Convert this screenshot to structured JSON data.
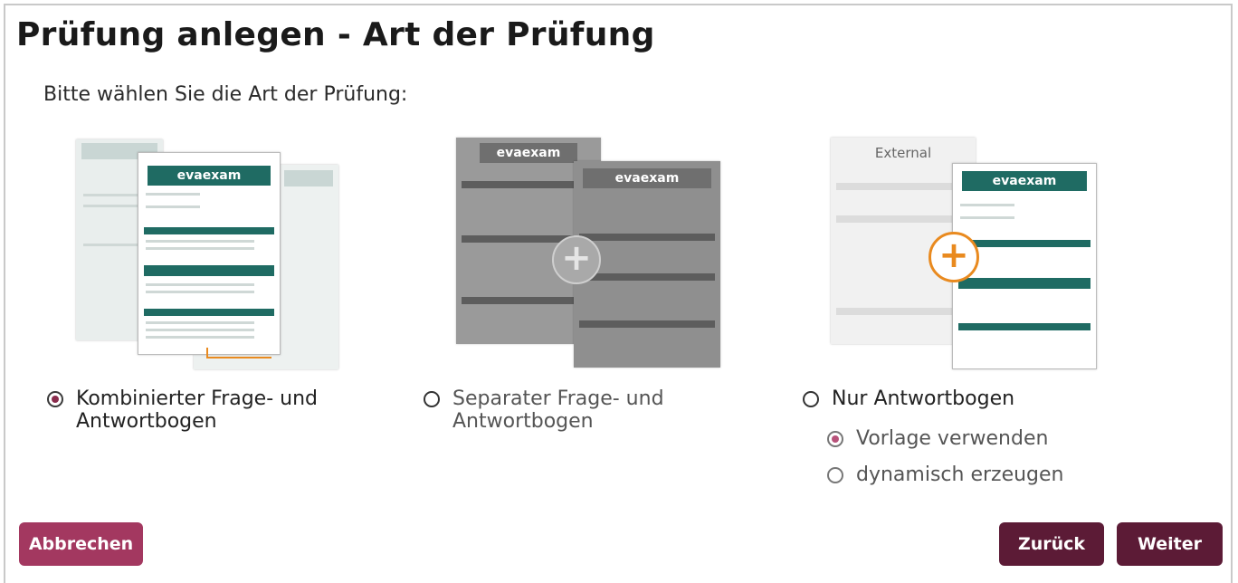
{
  "dialog": {
    "title": "Prüfung anlegen - Art der Prüfung",
    "prompt": "Bitte wählen Sie die Art der Prüfung:"
  },
  "illustrations": {
    "logo_text": "evaexam",
    "external_label": "External"
  },
  "options": [
    {
      "line1": "Kombinierter Frage- und",
      "line2": "Antwortbogen",
      "selected": true
    },
    {
      "line1": "Separater Frage- und",
      "line2": "Antwortbogen",
      "selected": false
    },
    {
      "line1": "Nur Antwortbogen",
      "line2": "",
      "selected": false
    }
  ],
  "sub_options": [
    {
      "label": "Vorlage verwenden",
      "selected": true
    },
    {
      "label": "dynamisch erzeugen",
      "selected": false
    }
  ],
  "buttons": {
    "cancel": "Abbrechen",
    "back": "Zurück",
    "next": "Weiter"
  },
  "colors": {
    "primary": "#5c1b36",
    "accent": "#a33860",
    "teal": "#1f6b63",
    "orange": "#e98a1f"
  }
}
